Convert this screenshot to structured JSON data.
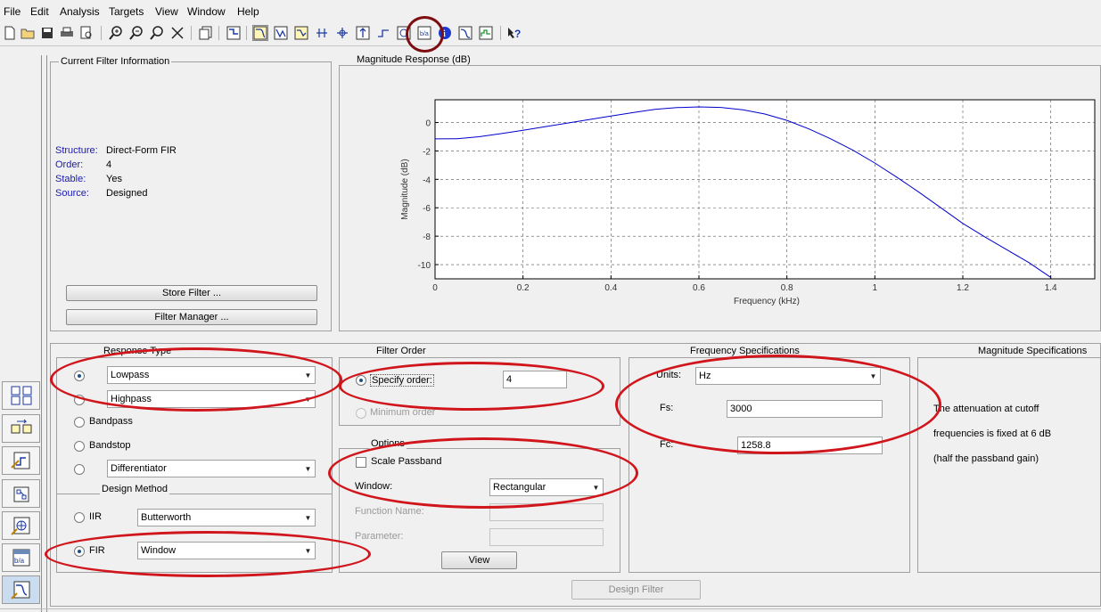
{
  "menu": [
    "File",
    "Edit",
    "Analysis",
    "Targets",
    "View",
    "Window",
    "Help"
  ],
  "toolbar": {
    "icons": [
      "new-file-icon",
      "open-folder-icon",
      "save-icon",
      "print-icon",
      "print-preview-icon",
      "zoom-in-icon",
      "zoom-out-icon",
      "zoom-x-icon",
      "zoom-fit-icon",
      "full-view-icon",
      "filter-spec-icon",
      "magnitude-response-icon",
      "phase-response-icon",
      "magphase-icon",
      "group-delay-icon",
      "pole-zero-icon",
      "impulse-response-icon",
      "step-response-icon",
      "filter-coefficients-icon",
      "filter-info-icon",
      "round-noise-icon",
      "what-is-this-icon"
    ]
  },
  "current_filter": {
    "title": "Current Filter Information",
    "rows": [
      {
        "key": "Structure:",
        "value": "Direct-Form FIR"
      },
      {
        "key": "Order:",
        "value": "4"
      },
      {
        "key": "Stable:",
        "value": "Yes"
      },
      {
        "key": "Source:",
        "value": "Designed"
      }
    ],
    "store_button": "Store Filter ...",
    "manager_button": "Filter Manager ..."
  },
  "plot": {
    "title": "Magnitude Response (dB)",
    "ylabel": "Magnitude (dB)",
    "xlabel": "Frequency (kHz)",
    "line_color": "#0000cc"
  },
  "chart_data": {
    "type": "line",
    "title": "Magnitude Response (dB)",
    "xlabel": "Frequency (kHz)",
    "ylabel": "Magnitude (dB)",
    "xlim": [
      0,
      1.5
    ],
    "ylim": [
      -11,
      1.6
    ],
    "xticks": [
      0,
      0.2,
      0.4,
      0.6,
      0.8,
      1,
      1.2,
      1.4
    ],
    "xtick_labels": [
      "0",
      "0.2",
      "0.4",
      "0.6",
      "0.8",
      "1",
      "1.2",
      "1.4"
    ],
    "yticks": [
      0,
      -2,
      -4,
      -6,
      -8,
      -10
    ],
    "ytick_labels": [
      "0",
      "-2",
      "-4",
      "-6",
      "-8",
      "-10"
    ],
    "grid": true,
    "series": [
      {
        "x": [
          0,
          0.05,
          0.1,
          0.15,
          0.2,
          0.25,
          0.3,
          0.35,
          0.4,
          0.45,
          0.5,
          0.55,
          0.6,
          0.65,
          0.7,
          0.75,
          0.8,
          0.85,
          0.9,
          0.95,
          1.0,
          1.05,
          1.1,
          1.15,
          1.2,
          1.25,
          1.3,
          1.35,
          1.4
        ],
        "y": [
          -1.15,
          -1.14,
          -1.0,
          -0.78,
          -0.55,
          -0.3,
          -0.05,
          0.2,
          0.45,
          0.7,
          0.92,
          1.05,
          1.1,
          1.06,
          0.9,
          0.6,
          0.15,
          -0.45,
          -1.15,
          -1.95,
          -2.85,
          -3.85,
          -4.9,
          -6.0,
          -7.1,
          -8.05,
          -8.95,
          -9.85,
          -10.9
        ]
      }
    ]
  },
  "response_type": {
    "title": "Response Type",
    "options": [
      "Lowpass",
      "Highpass",
      "Bandpass",
      "Bandstop",
      "Differentiator"
    ],
    "lowpass_value": "Lowpass",
    "highpass_value": "Highpass",
    "bandpass_label": "Bandpass",
    "bandstop_label": "Bandstop",
    "differentiator_value": "Differentiator"
  },
  "design_method": {
    "title": "Design Method",
    "iir_label": "IIR",
    "iir_value": "Butterworth",
    "fir_label": "FIR",
    "fir_value": "Window"
  },
  "filter_order": {
    "title": "Filter Order",
    "specify_label": "Specify order:",
    "order_value": "4",
    "minimum_label": "Minimum order"
  },
  "options": {
    "title": "Options",
    "scale_passband": "Scale Passband",
    "window_label": "Window:",
    "window_value": "Rectangular",
    "function_name_label": "Function Name:",
    "parameter_label": "Parameter:",
    "view_button": "View"
  },
  "frequency_specs": {
    "title": "Frequency Specifications",
    "units_label": "Units:",
    "units_value": "Hz",
    "fs_label": "Fs:",
    "fs_value": "3000",
    "fc_label": "Fc:",
    "fc_value": "1258.8"
  },
  "magnitude_specs": {
    "title": "Magnitude Specifications",
    "line1": "The attenuation at cutoff",
    "line2": "frequencies is fixed at 6 dB",
    "line3": "(half the passband gain)"
  },
  "design_button": "Design Filter"
}
